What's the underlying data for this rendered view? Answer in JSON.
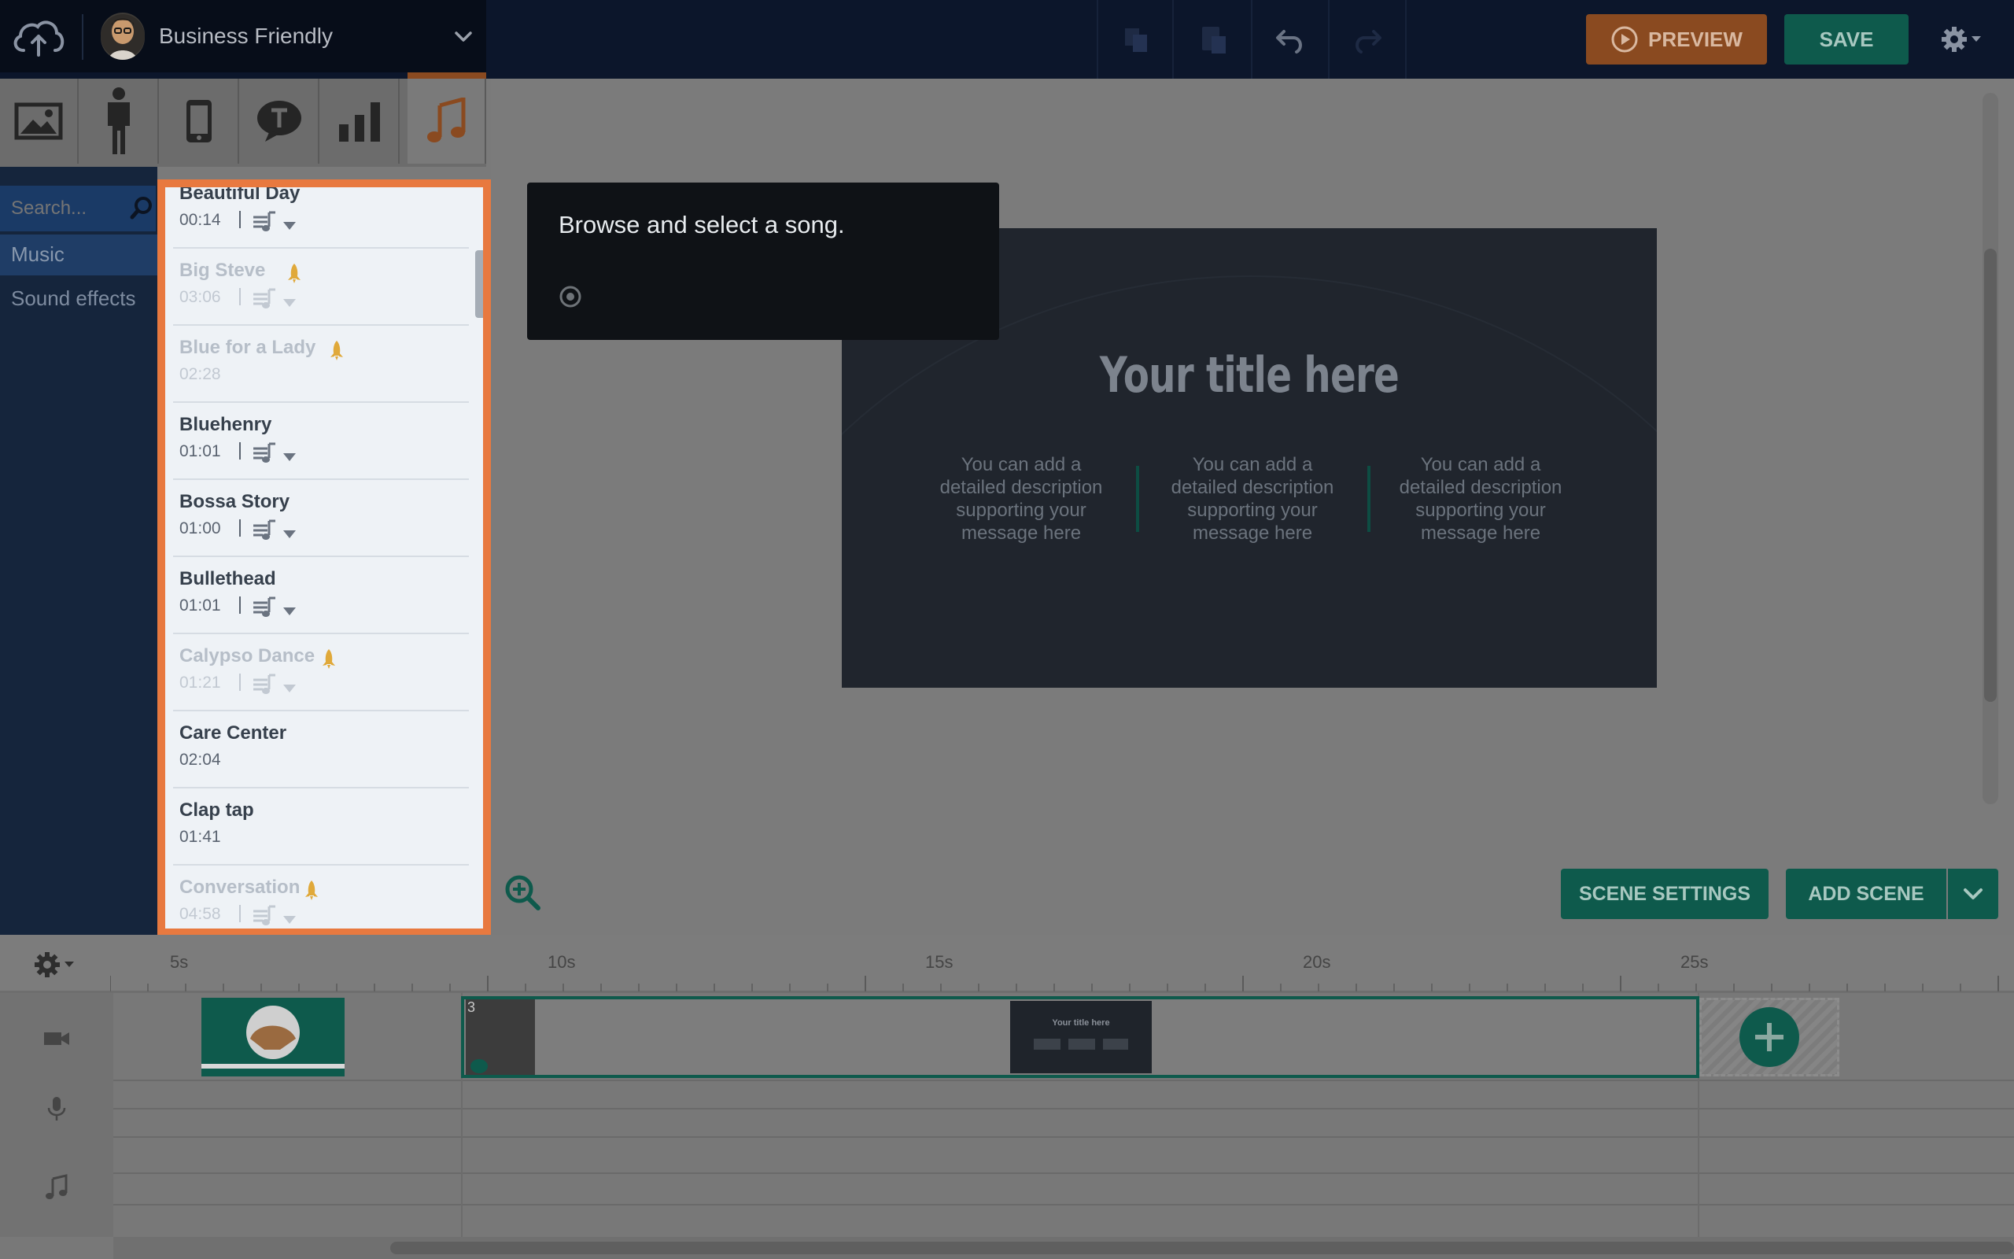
{
  "header": {
    "theme_name": "Business Friendly",
    "preview_label": "PREVIEW",
    "save_label": "SAVE"
  },
  "asset_tabs": [
    {
      "name": "images",
      "icon": "image-icon"
    },
    {
      "name": "characters",
      "icon": "character-icon"
    },
    {
      "name": "devices",
      "icon": "phone-icon"
    },
    {
      "name": "text",
      "icon": "speech-bubble-icon"
    },
    {
      "name": "charts",
      "icon": "bar-chart-icon"
    },
    {
      "name": "music",
      "icon": "music-note-icon",
      "active": true
    }
  ],
  "sidebar": {
    "search_placeholder": "Search...",
    "categories": [
      {
        "label": "Music",
        "active": true
      },
      {
        "label": "Sound effects"
      }
    ]
  },
  "songs": [
    {
      "title": "Beautiful Day",
      "duration": "00:14",
      "locked": false,
      "tools": true
    },
    {
      "title": "Big Steve",
      "duration": "03:06",
      "locked": true,
      "tools": true
    },
    {
      "title": "Blue for a Lady",
      "duration": "02:28",
      "locked": true,
      "tools": false
    },
    {
      "title": "Bluehenry",
      "duration": "01:01",
      "locked": false,
      "tools": true
    },
    {
      "title": "Bossa Story",
      "duration": "01:00",
      "locked": false,
      "tools": true
    },
    {
      "title": "Bullethead",
      "duration": "01:01",
      "locked": false,
      "tools": true
    },
    {
      "title": "Calypso Dance",
      "duration": "01:21",
      "locked": true,
      "tools": true
    },
    {
      "title": "Care Center",
      "duration": "02:04",
      "locked": false,
      "tools": false
    },
    {
      "title": "Clap tap",
      "duration": "01:41",
      "locked": false,
      "tools": false
    },
    {
      "title": "Conversation",
      "duration": "04:58",
      "locked": true,
      "tools": true
    }
  ],
  "tooltip": {
    "text": "Browse and select a song."
  },
  "canvas": {
    "title": "Your title here",
    "descriptions": [
      "You can add a detailed description supporting your message here",
      "You can add a detailed description supporting your message here",
      "You can add a detailed description supporting your message here"
    ]
  },
  "stage_buttons": {
    "scene_settings": "SCENE SETTINGS",
    "add_scene": "ADD SCENE"
  },
  "timeline": {
    "ticks": [
      "5s",
      "10s",
      "15s",
      "20s",
      "25s"
    ],
    "clip_number": "3",
    "clip_thumb_title": "Your title here"
  },
  "colors": {
    "accent_orange": "#e8793f",
    "brand_green": "#0e5a4c",
    "navy": "#0c162b",
    "lock_yellow": "#e0a93a"
  }
}
